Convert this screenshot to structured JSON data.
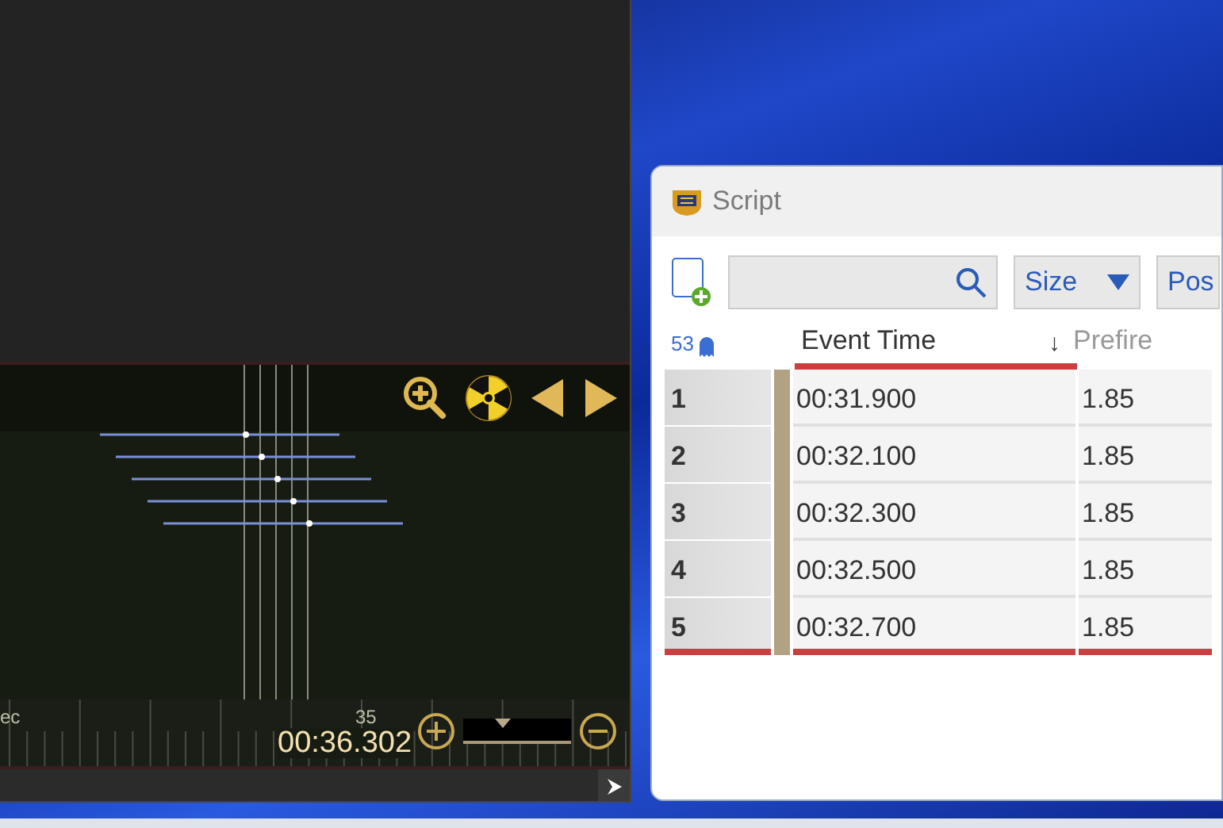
{
  "timeline": {
    "ruler_label": "ec",
    "tick_label": "35",
    "current_time": "00:36.302",
    "zoom_slider": {
      "level": 0.35
    }
  },
  "script_window": {
    "title": "Script",
    "size_dropdown": "Size",
    "cut_button": "Pos",
    "event_count": "53",
    "columns": [
      {
        "label": "Event Time",
        "sorted": true,
        "sort_indicator": "↓"
      },
      {
        "label": "Prefire",
        "sorted": false
      }
    ],
    "rows": [
      {
        "number": "1",
        "event_time": "00:31.900",
        "prefire": "1.85",
        "selected": false
      },
      {
        "number": "2",
        "event_time": "00:32.100",
        "prefire": "1.85",
        "selected": false
      },
      {
        "number": "3",
        "event_time": "00:32.300",
        "prefire": "1.85",
        "selected": false
      },
      {
        "number": "4",
        "event_time": "00:32.500",
        "prefire": "1.85",
        "selected": false
      },
      {
        "number": "5",
        "event_time": "00:32.700",
        "prefire": "1.85",
        "selected": true
      }
    ]
  }
}
